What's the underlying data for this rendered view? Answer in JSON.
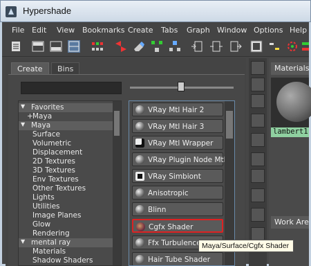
{
  "window": {
    "title": "Hypershade"
  },
  "menu": [
    "File",
    "Edit",
    "View",
    "Bookmarks",
    "Create",
    "Tabs",
    "Graph",
    "Window",
    "Options",
    "Help"
  ],
  "toolbar": {
    "icons": [
      "list-icon",
      "layout-top-icon",
      "layout-bottom-icon",
      "layout-both-icon",
      "graph-network-icon",
      "eraser-icon",
      "graph-upstream-icon",
      "graph-downstream-icon",
      "input-icon",
      "input-output-icon",
      "output-icon",
      "render-icon",
      "toggle-icon",
      "graph-render-icon"
    ]
  },
  "tabs": {
    "create": "Create",
    "bins": "Bins"
  },
  "tree": [
    {
      "label": "Favorites",
      "level": 0,
      "header": true
    },
    {
      "label": "Maya",
      "level": 1,
      "prefix": "+",
      "header": false
    },
    {
      "label": "Maya",
      "level": 0,
      "header": true
    },
    {
      "label": "Surface",
      "level": 1,
      "header": false
    },
    {
      "label": "Volumetric",
      "level": 1,
      "header": false
    },
    {
      "label": "Displacement",
      "level": 1,
      "header": false
    },
    {
      "label": "2D Textures",
      "level": 1,
      "header": false
    },
    {
      "label": "3D Textures",
      "level": 1,
      "header": false
    },
    {
      "label": "Env Textures",
      "level": 1,
      "header": false
    },
    {
      "label": "Other Textures",
      "level": 1,
      "header": false
    },
    {
      "label": "Lights",
      "level": 1,
      "header": false
    },
    {
      "label": "Utilities",
      "level": 1,
      "header": false
    },
    {
      "label": "Image Planes",
      "level": 1,
      "header": false
    },
    {
      "label": "Glow",
      "level": 1,
      "header": false
    },
    {
      "label": "Rendering",
      "level": 1,
      "header": false
    },
    {
      "label": "mental ray",
      "level": 0,
      "header": true
    },
    {
      "label": "Materials",
      "level": 1,
      "header": false
    },
    {
      "label": "Shadow Shaders",
      "level": 1,
      "header": false
    }
  ],
  "nodes": [
    {
      "label": "VRay Mtl Hair 2",
      "icon": "sphere-icon"
    },
    {
      "label": "VRay Mtl Hair 3",
      "icon": "sphere-icon"
    },
    {
      "label": "VRay Mtl Wrapper",
      "icon": "wrapper-icon"
    },
    {
      "label": "VRay Plugin Node Mtl",
      "icon": "sphere-icon"
    },
    {
      "label": "VRay Simbiont",
      "icon": "simbiont-icon"
    },
    {
      "label": "Anisotropic",
      "icon": "sphere-icon"
    },
    {
      "label": "Blinn",
      "icon": "sphere-icon"
    },
    {
      "label": "Cgfx Shader",
      "icon": "cgfx-icon",
      "selected": true
    },
    {
      "label": "Ffx Turbulence Shader",
      "icon": "sphere-icon"
    },
    {
      "label": "Hair Tube Shader",
      "icon": "sphere-icon"
    }
  ],
  "right_panel": {
    "tab": "Materials",
    "material_name": "lambert1",
    "work_area_tab": "Work Area"
  },
  "tooltip": "Maya/Surface/Cgfx Shader"
}
